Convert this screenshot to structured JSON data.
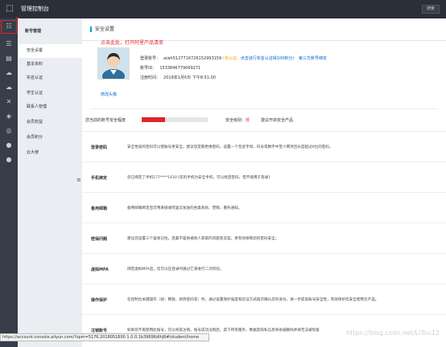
{
  "header": {
    "logo_icon": "console-logo-icon",
    "title": "管理控制台",
    "search_label": "搜索"
  },
  "annotation": {
    "text": "点击此处，打开阿里产品清单",
    "color": "#e0262a"
  },
  "rail": {
    "icons": [
      "grid-icon",
      "menu-icon",
      "cloud-server-icon",
      "upload-icon",
      "cloud-icon",
      "scissors-icon",
      "shield-icon",
      "globe-icon",
      "earth-icon",
      "circle-icon"
    ]
  },
  "subnav": {
    "title": "账号管理",
    "items": [
      {
        "label": "安全设置",
        "active": true
      },
      {
        "label": "基本资料",
        "active": false
      },
      {
        "label": "实名认证",
        "active": false
      },
      {
        "label": "学生认证",
        "active": false
      },
      {
        "label": "联系人管理",
        "active": false
      },
      {
        "label": "会员权益",
        "active": false
      },
      {
        "label": "会员积分",
        "active": false
      },
      {
        "label": "云大使",
        "active": false
      }
    ]
  },
  "main": {
    "section_title": "安全设置",
    "profile": {
      "edit_avatar": "修改头像",
      "login_label": "登录账号：",
      "login_value": "aiwh5127716726152993159",
      "unverified": "(未认证，",
      "verify_link": "点击进行实名认证得100积分)",
      "third_party": "第三方账号绑定",
      "id_label": "账号ID：",
      "id_value": "1533846779069271",
      "reg_label": "注册时间：",
      "reg_value": "2019年1月6日 下午8:51:00"
    },
    "security_level": {
      "label": "您当前的账号安全程度",
      "progress_fraction": 0.35,
      "level_prefix": "安全级别：",
      "level_value": "低",
      "improve": "建议开启安全产品"
    },
    "rows": [
      {
        "name": "登录密码",
        "desc": "安全性高的密码可以使账号更安全。建议您定期更换密码，设置一个包含字母，符号或数字中至少两项且长度超过6位的密码。"
      },
      {
        "name": "手机绑定",
        "desc": "您已绑定了手机177****1410 [您的手机为安全手机，可以找回密码，但不能用于登录]"
      },
      {
        "name": "备用邮箱",
        "desc": "备用邮箱绑定后可用来接收阿里云发送的各类系统、营销、服务通知。"
      },
      {
        "name": "密保问题",
        "desc": "建议您设置三个容易记住，且最不容易被他人获取的问题及答案，更有效保障您的密码安全。"
      },
      {
        "name": "虚拟MFA",
        "desc": "绑定虚拟MFA后，您可以在登录时通过它来进行二次校验。"
      },
      {
        "name": "操作保护",
        "desc": "在控制台关键操作（如：释放、修改密码等）时，通过设置保护强度和验证方式再次确认您的身份，进一步提高账号安全性，有效保护您安全使用云产品。"
      },
      {
        "name": "注销账号",
        "desc": "如果您不再使用此账号，可以将其注销。账号成功注销后，其下所有服务、数据及隐私信息将会被删除并将无法被恢复"
      }
    ]
  },
  "statusbar": {
    "url": "https://account.console.aliyun.com/?spm=5176.2018051600 1.0.0.1b39696dlhJ6#/student/home"
  },
  "watermark": "https://blog.csdn.net/LiTou12"
}
